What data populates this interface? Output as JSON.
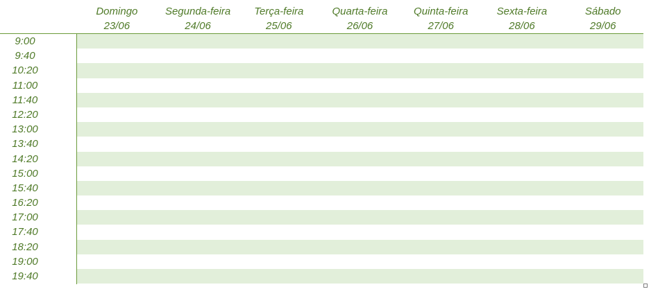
{
  "days": [
    {
      "name": "Domingo",
      "date": "23/06"
    },
    {
      "name": "Segunda-feira",
      "date": "24/06"
    },
    {
      "name": "Terça-feira",
      "date": "25/06"
    },
    {
      "name": "Quarta-feira",
      "date": "26/06"
    },
    {
      "name": "Quinta-feira",
      "date": "27/06"
    },
    {
      "name": "Sexta-feira",
      "date": "28/06"
    },
    {
      "name": "Sábado",
      "date": "29/06"
    }
  ],
  "times": [
    "9:00",
    "9:40",
    "10:20",
    "11:00",
    "11:40",
    "12:20",
    "13:00",
    "13:40",
    "14:20",
    "15:00",
    "15:40",
    "16:20",
    "17:00",
    "17:40",
    "18:20",
    "19:00",
    "19:40"
  ],
  "colors": {
    "text": "#4f7a28",
    "band": "#e2efda",
    "rule": "#6a9a3a"
  }
}
